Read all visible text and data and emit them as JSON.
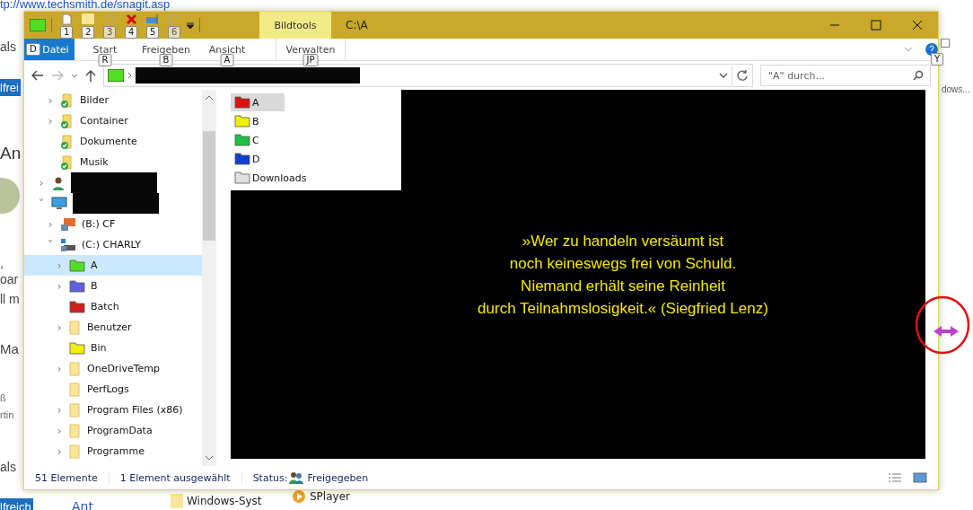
{
  "background_page": {
    "url": "tp://www.techsmith.de/snagit.asp",
    "left_texts": [
      {
        "kind": "plain",
        "text": "als"
      },
      {
        "kind": "button",
        "text": "lfrei"
      },
      {
        "kind": "heading",
        "text": "An"
      },
      {
        "kind": "avatar"
      },
      {
        "kind": "plain",
        "text": ","
      },
      {
        "kind": "plain",
        "text": "oar"
      },
      {
        "kind": "plain",
        "text": "ll m"
      },
      {
        "kind": "heading-small",
        "text": "Ma"
      },
      {
        "kind": "small",
        "text": "ß"
      },
      {
        "kind": "small",
        "text": "rtin"
      },
      {
        "kind": "plain",
        "text": "als"
      },
      {
        "kind": "button",
        "text": "lfreich"
      }
    ],
    "bottom_texts": [
      {
        "kind": "link",
        "text": "Ant"
      },
      {
        "kind": "folder",
        "text": "Windows-Syst"
      },
      {
        "kind": "player",
        "text": "SPlayer"
      }
    ],
    "checkbox": {
      "checked": false
    },
    "right_text": "dows..."
  },
  "window": {
    "title": "C:\\A",
    "context_tab": "Bildtools",
    "quick_access": [
      {
        "key": "1",
        "disabled": false,
        "kind": "properties"
      },
      {
        "key": "2",
        "disabled": false,
        "kind": "folder"
      },
      {
        "key": "3",
        "disabled": true,
        "kind": "undo"
      },
      {
        "key": "4",
        "disabled": false,
        "kind": "delete"
      },
      {
        "key": "5",
        "disabled": false,
        "kind": "rename"
      },
      {
        "key": "6",
        "disabled": true,
        "kind": "redo"
      }
    ],
    "ribbon_tabs": [
      {
        "label": "Datei",
        "key": "D",
        "kind": "file"
      },
      {
        "label": "Start",
        "key": "R",
        "kind": "tab"
      },
      {
        "label": "Freigeben",
        "key": "B",
        "kind": "tab"
      },
      {
        "label": "Ansicht",
        "key": "A",
        "kind": "tab"
      },
      {
        "label": "Verwalten",
        "key": "JP",
        "kind": "context"
      }
    ],
    "help_key": "Y",
    "search": {
      "placeholder": "\"A\" durch..."
    },
    "tree": {
      "partial_children": [
        {
          "label": "Bilder",
          "kind": "library",
          "chevron": "›",
          "selected": false
        },
        {
          "label": "Container",
          "kind": "library",
          "chevron": "›",
          "selected": false
        },
        {
          "label": "Dokumente",
          "kind": "library",
          "selected": false
        },
        {
          "label": "Musik",
          "kind": "library",
          "selected": false
        }
      ],
      "items": [
        {
          "redacted": true,
          "kind": "user",
          "chevron": "›",
          "selected": false
        },
        {
          "redacted": true,
          "kind": "pc",
          "chevron": "˅",
          "selected": false,
          "children": [
            {
              "label": "(B:) CF",
              "kind": "drive",
              "chevron": "›",
              "selected": false
            },
            {
              "label": "(C:) CHARLY",
              "kind": "system-drive",
              "chevron": "˅",
              "selected": false,
              "children": [
                {
                  "label": "A",
                  "kind": "green-folder",
                  "chevron": "›",
                  "selected": true
                },
                {
                  "label": "B",
                  "kind": "blue-folder",
                  "chevron": "›",
                  "selected": false
                },
                {
                  "label": "Batch",
                  "kind": "red-folder",
                  "selected": false
                },
                {
                  "label": "Benutzer",
                  "kind": "folder",
                  "chevron": "›",
                  "selected": false
                },
                {
                  "label": "Bin",
                  "kind": "yellow-folder",
                  "selected": false
                },
                {
                  "label": "OneDriveTemp",
                  "kind": "folder",
                  "chevron": "›",
                  "selected": false
                },
                {
                  "label": "PerfLogs",
                  "kind": "folder",
                  "selected": false
                },
                {
                  "label": "Program Files (x86)",
                  "kind": "folder",
                  "chevron": "›",
                  "selected": false
                },
                {
                  "label": "ProgramData",
                  "kind": "folder",
                  "chevron": "›",
                  "selected": false
                },
                {
                  "label": "Programme",
                  "kind": "folder",
                  "chevron": "›",
                  "selected": false
                }
              ]
            }
          ]
        }
      ]
    },
    "files": [
      {
        "name": "A",
        "color": "#e01010",
        "selected": true
      },
      {
        "name": "B",
        "color": "#f0f000",
        "selected": false
      },
      {
        "name": "C",
        "color": "#20c040",
        "selected": false
      },
      {
        "name": "D",
        "color": "#1040d0",
        "selected": false
      },
      {
        "name": "Downloads",
        "color": "#e0e0e0",
        "selected": false
      }
    ],
    "quote": [
      "»Wer zu handeln versäumt ist",
      "noch keineswegs frei von Schuld.",
      "Niemand erhält seine Reinheit",
      "durch Teilnahmslosigkeit.« (Siegfried Lenz)"
    ],
    "status_bar": {
      "count": "51 Elemente",
      "selection": "1 Element ausgewählt",
      "status_label": "Status:",
      "status_value": "Freigegeben"
    }
  }
}
